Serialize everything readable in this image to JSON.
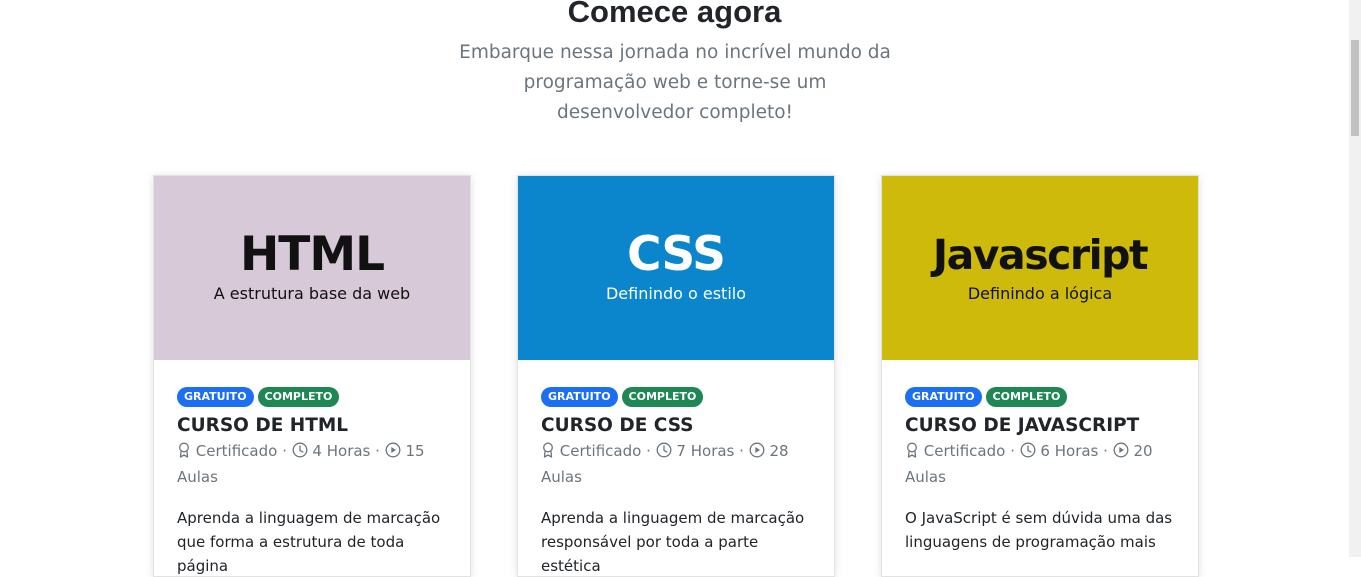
{
  "header": {
    "title": "Comece agora",
    "subtitle": "Embarque nessa jornada no incrível mundo da programação web e torne-se um desenvolvedor completo!"
  },
  "colors": {
    "badge_free": "#1d6ff2",
    "badge_complete": "#1e8753",
    "html_banner": "#d7c9d7",
    "css_banner": "#0b85cc",
    "js_banner": "#cdba0a"
  },
  "cards": [
    {
      "banner_title": "HTML",
      "banner_subtitle": "A estrutura base da web",
      "badge_free": "GRATUITO",
      "badge_complete": "COMPLETO",
      "course_title": "CURSO DE HTML",
      "certificate": "Certificado",
      "separator": "·",
      "hours": "4 Horas",
      "lessons": "15 Aulas",
      "description": "Aprenda a linguagem de marcação que forma a estrutura de toda página"
    },
    {
      "banner_title": "CSS",
      "banner_subtitle": "Definindo o estilo",
      "badge_free": "GRATUITO",
      "badge_complete": "COMPLETO",
      "course_title": "CURSO DE CSS",
      "certificate": "Certificado",
      "separator": "·",
      "hours": "7 Horas",
      "lessons": "28 Aulas",
      "description": "Aprenda a linguagem de marcação responsável por toda a parte estética"
    },
    {
      "banner_title": "Javascript",
      "banner_subtitle": "Definindo a lógica",
      "badge_free": "GRATUITO",
      "badge_complete": "COMPLETO",
      "course_title": "CURSO DE JAVASCRIPT",
      "certificate": "Certificado",
      "separator": "·",
      "hours": "6 Horas",
      "lessons": "20 Aulas",
      "description": "O JavaScript é sem dúvida uma das linguagens de programação mais"
    }
  ]
}
